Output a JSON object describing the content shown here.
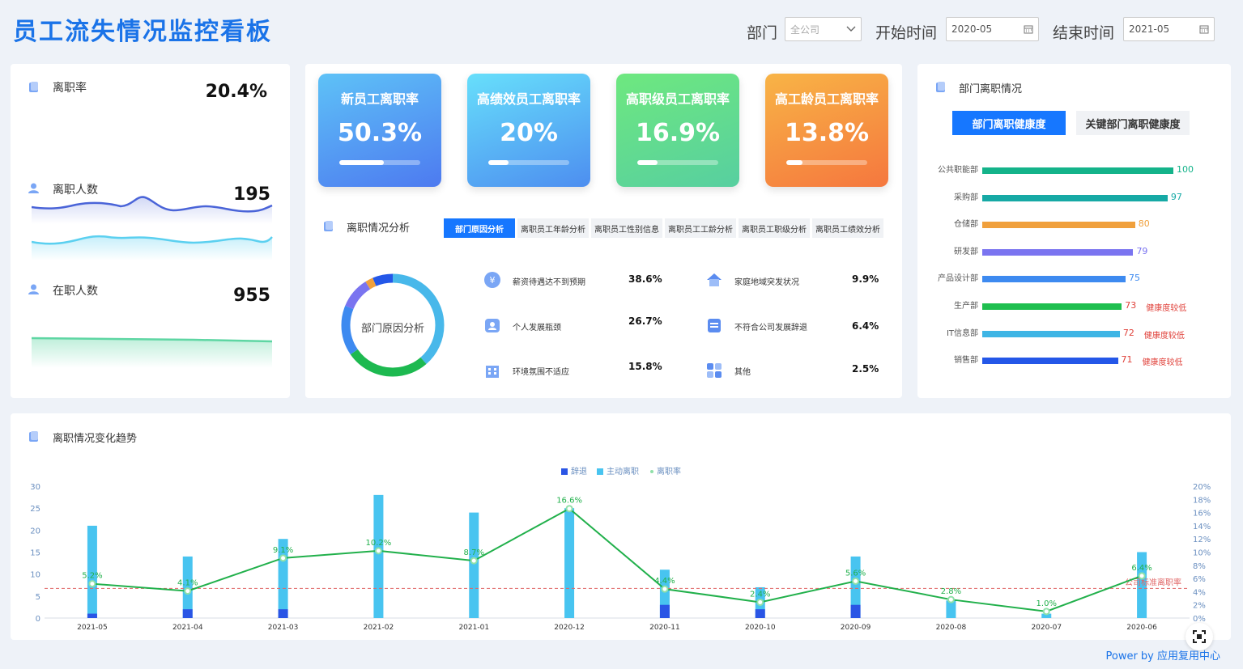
{
  "header": {
    "title": "员工流失情况监控看板",
    "dept_label": "部门",
    "dept_value": "全公司",
    "start_label": "开始时间",
    "start_value": "2020-05",
    "end_label": "结束时间",
    "end_value": "2021-05"
  },
  "metrics": {
    "rate_label": "离职率",
    "rate_value": "20.4%",
    "leave_label": "离职人数",
    "leave_value": "195",
    "active_label": "在职人数",
    "active_value": "955"
  },
  "kpis": [
    {
      "label": "新员工离职率",
      "value": "50.3%",
      "fill": 0.55
    },
    {
      "label": "高绩效员工离职率",
      "value": "20%",
      "fill": 0.25
    },
    {
      "label": "高职级员工离职率",
      "value": "16.9%",
      "fill": 0.25
    },
    {
      "label": "高工龄员工离职率",
      "value": "13.8%",
      "fill": 0.2
    }
  ],
  "analysis": {
    "title": "离职情况分析",
    "tabs": [
      "部门原因分析",
      "离职员工年龄分析",
      "离职员工性别信息",
      "离职员工工龄分析",
      "离职员工职级分析",
      "离职员工绩效分析"
    ],
    "donut_label": "部门原因分析",
    "reasons": [
      {
        "label": "薪资待遇达不到预期",
        "value": "38.6%"
      },
      {
        "label": "家庭地域突发状况",
        "value": "9.9%"
      },
      {
        "label": "个人发展瓶颈",
        "value": "26.7%"
      },
      {
        "label": "不符合公司发展辞退",
        "value": "6.4%"
      },
      {
        "label": "环境氛围不适应",
        "value": "15.8%"
      },
      {
        "label": "其他",
        "value": "2.5%"
      }
    ]
  },
  "dept": {
    "title": "部门离职情况",
    "tab_active": "部门离职健康度",
    "tab_other": "关键部门离职健康度",
    "warn_text": "健康度较低",
    "rows": [
      {
        "name": "公共职能部",
        "value": 100,
        "color": "#14b38a"
      },
      {
        "name": "采购部",
        "value": 97,
        "color": "#16a9a5"
      },
      {
        "name": "仓储部",
        "value": 80,
        "color": "#f0a03c"
      },
      {
        "name": "研发部",
        "value": 79,
        "color": "#7a74f0"
      },
      {
        "name": "产品设计部",
        "value": 75,
        "color": "#3d8af0"
      },
      {
        "name": "生产部",
        "value": 73,
        "color": "#1fbf4f"
      },
      {
        "name": "IT信息部",
        "value": 72,
        "color": "#3eb5e5"
      },
      {
        "name": "销售部",
        "value": 71,
        "color": "#2457e8"
      }
    ]
  },
  "trend": {
    "title": "离职情况变化趋势",
    "legend": [
      "辞退",
      "主动离职",
      "离职率"
    ],
    "ref_label": "公司标准离职率",
    "powered": "Power by 应用复用中心"
  },
  "chart_data": {
    "type": "bar",
    "categories": [
      "2021-05",
      "2021-04",
      "2021-03",
      "2021-02",
      "2021-01",
      "2020-12",
      "2020-11",
      "2020-10",
      "2020-09",
      "2020-08",
      "2020-07",
      "2020-06"
    ],
    "series": [
      {
        "name": "辞退",
        "values": [
          1,
          2,
          2,
          0,
          0,
          0,
          3,
          2,
          3,
          0,
          0,
          0
        ]
      },
      {
        "name": "主动离职",
        "values": [
          21,
          14,
          18,
          28,
          24,
          25,
          11,
          7,
          14,
          4,
          1,
          15
        ]
      },
      {
        "name": "离职率",
        "values": [
          5.2,
          4.1,
          9.1,
          10.2,
          8.7,
          16.6,
          4.4,
          2.4,
          5.6,
          2.8,
          1.0,
          6.4
        ],
        "axis": "right"
      }
    ],
    "ylim": [
      0,
      30
    ],
    "yticks": [
      0,
      5,
      10,
      15,
      20,
      25,
      30
    ],
    "y2lim": [
      0,
      20
    ],
    "y2ticks": [
      "0%",
      "2%",
      "4%",
      "6%",
      "8%",
      "10%",
      "12%",
      "14%",
      "16%",
      "18%",
      "20%"
    ],
    "reference_rate": 4.5,
    "legend_position": "top-center",
    "colors": {
      "dismiss": "#2a55e5",
      "voluntary": "#48c4f0",
      "rate": "#21b04b",
      "reference": "#e06666"
    }
  }
}
